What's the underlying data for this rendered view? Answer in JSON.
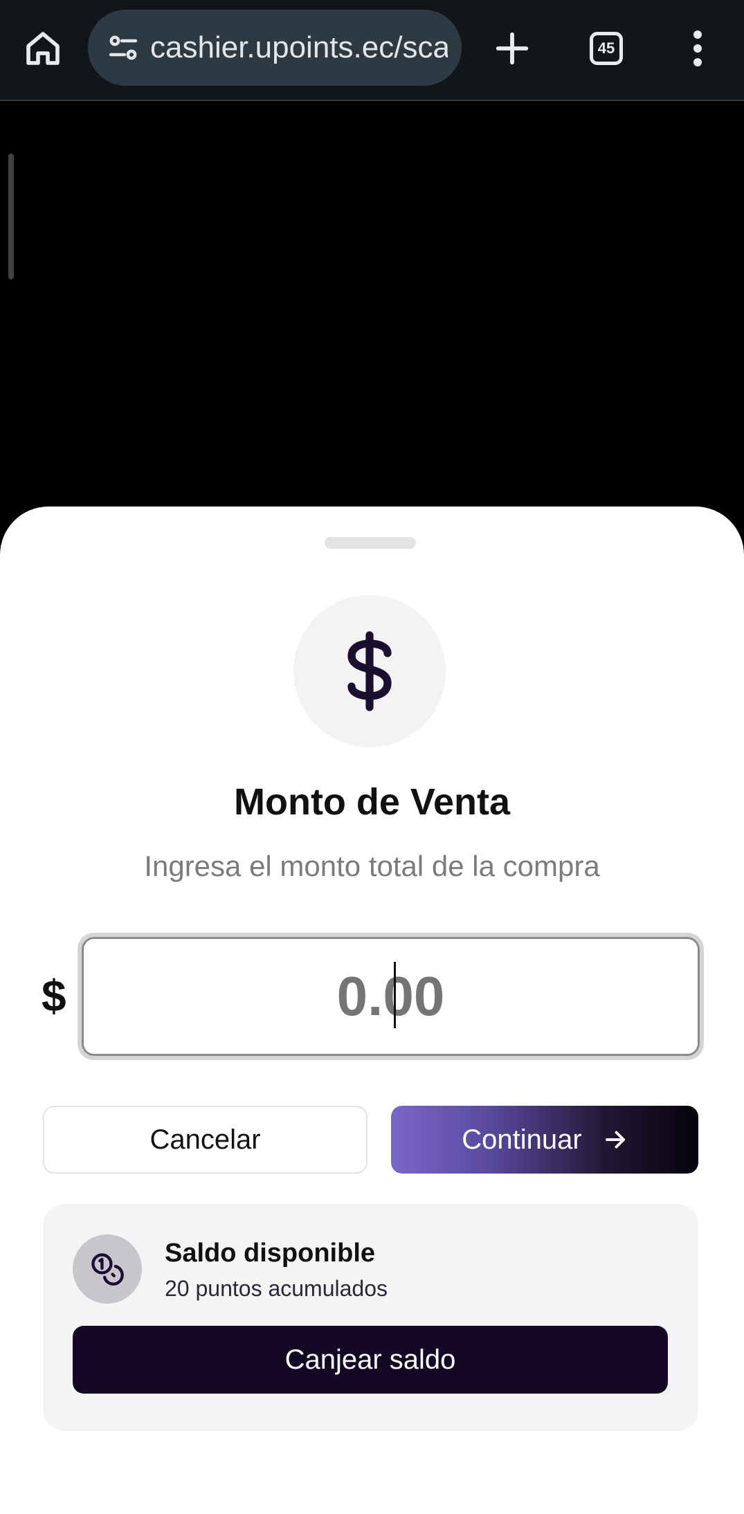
{
  "browser": {
    "url": "cashier.upoints.ec/sca",
    "tab_count": "45",
    "icons": [
      "home-icon",
      "site-settings-icon",
      "plus-icon",
      "tab-switcher-icon",
      "more-vert-icon"
    ]
  },
  "sheet": {
    "icon": "dollar-icon",
    "title": "Monto de Venta",
    "subtitle": "Ingresa el monto total de la compra",
    "currency_symbol": "$",
    "amount_value": "",
    "amount_placeholder": "0.00",
    "cancel_label": "Cancelar",
    "continue_label": "Continuar",
    "continue_icon": "arrow-right-icon",
    "balance": {
      "icon": "coins-icon",
      "title": "Saldo disponible",
      "points_text": "20 puntos acumulados",
      "redeem_label": "Canjear saldo"
    }
  },
  "colors": {
    "browser_bar": "#121519",
    "url_bar": "#2d3a44",
    "overlay": "#000000",
    "primary_dark": "#140824",
    "accent_purple": "#7a66c9",
    "card_bg": "#f4f4f5"
  }
}
